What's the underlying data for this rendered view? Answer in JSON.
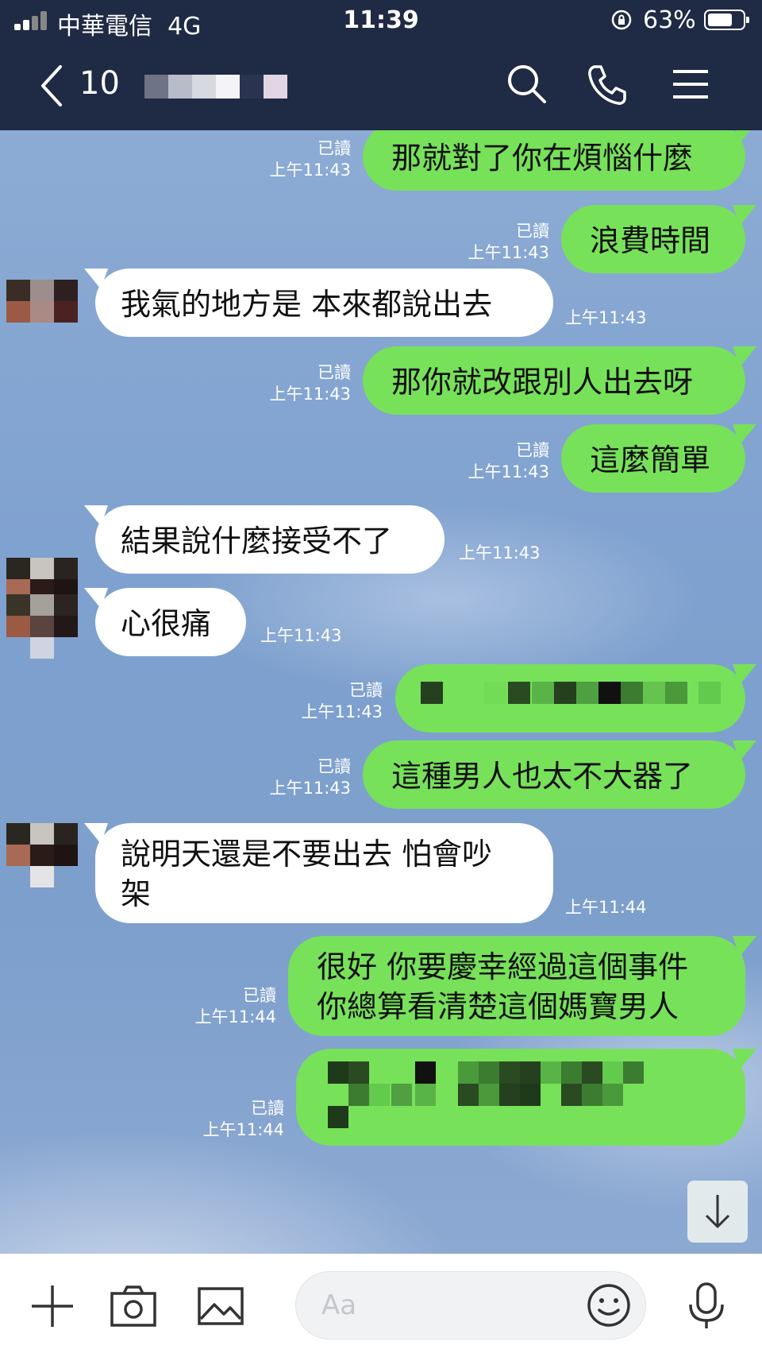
{
  "status_bar": {
    "carrier": "中華電信",
    "network": "4G",
    "time": "11:39",
    "battery": "63%"
  },
  "header": {
    "unread_count": "10"
  },
  "messages": [
    {
      "side": "out",
      "text": "那就對了你在煩惱什麼",
      "read": "已讀",
      "time": "上午11:43"
    },
    {
      "side": "out",
      "text": "浪費時間",
      "read": "已讀",
      "time": "上午11:43"
    },
    {
      "side": "in",
      "text": "我氣的地方是 本來都說出去",
      "time": "上午11:43"
    },
    {
      "side": "out",
      "text": "那你就改跟別人出去呀",
      "read": "已讀",
      "time": "上午11:43"
    },
    {
      "side": "out",
      "text": "這麼簡單",
      "read": "已讀",
      "time": "上午11:43"
    },
    {
      "side": "in",
      "text": "結果說什麼接受不了",
      "time": "上午11:43"
    },
    {
      "side": "in",
      "text": "心很痛",
      "time": "上午11:43"
    },
    {
      "side": "out",
      "text": "",
      "read": "已讀",
      "time": "上午11:43"
    },
    {
      "side": "out",
      "text": "這種男人也太不大器了",
      "read": "已讀",
      "time": "上午11:43"
    },
    {
      "side": "in",
      "line1": "說明天還是不要出去 怕會吵",
      "line2": "架",
      "time": "上午11:44"
    },
    {
      "side": "out",
      "line1": "很好 你要慶幸經過這個事件",
      "line2": "你總算看清楚這個媽寶男人",
      "read": "已讀",
      "time": "上午11:44"
    },
    {
      "side": "out",
      "text": "",
      "read": "已讀",
      "time": "上午11:44"
    }
  ],
  "composer": {
    "placeholder": "Aa"
  },
  "icons": [
    "back-icon",
    "search-icon",
    "phone-icon",
    "menu-icon",
    "plus-icon",
    "camera-icon",
    "image-icon",
    "emoji-icon",
    "mic-icon",
    "arrow-down-icon",
    "orientation-lock-icon"
  ],
  "colors": {
    "header": "#1f2a44",
    "outgoing_bubble": "#77e15a",
    "incoming_bubble": "#ffffff",
    "chat_background": "#7fa1cf"
  }
}
